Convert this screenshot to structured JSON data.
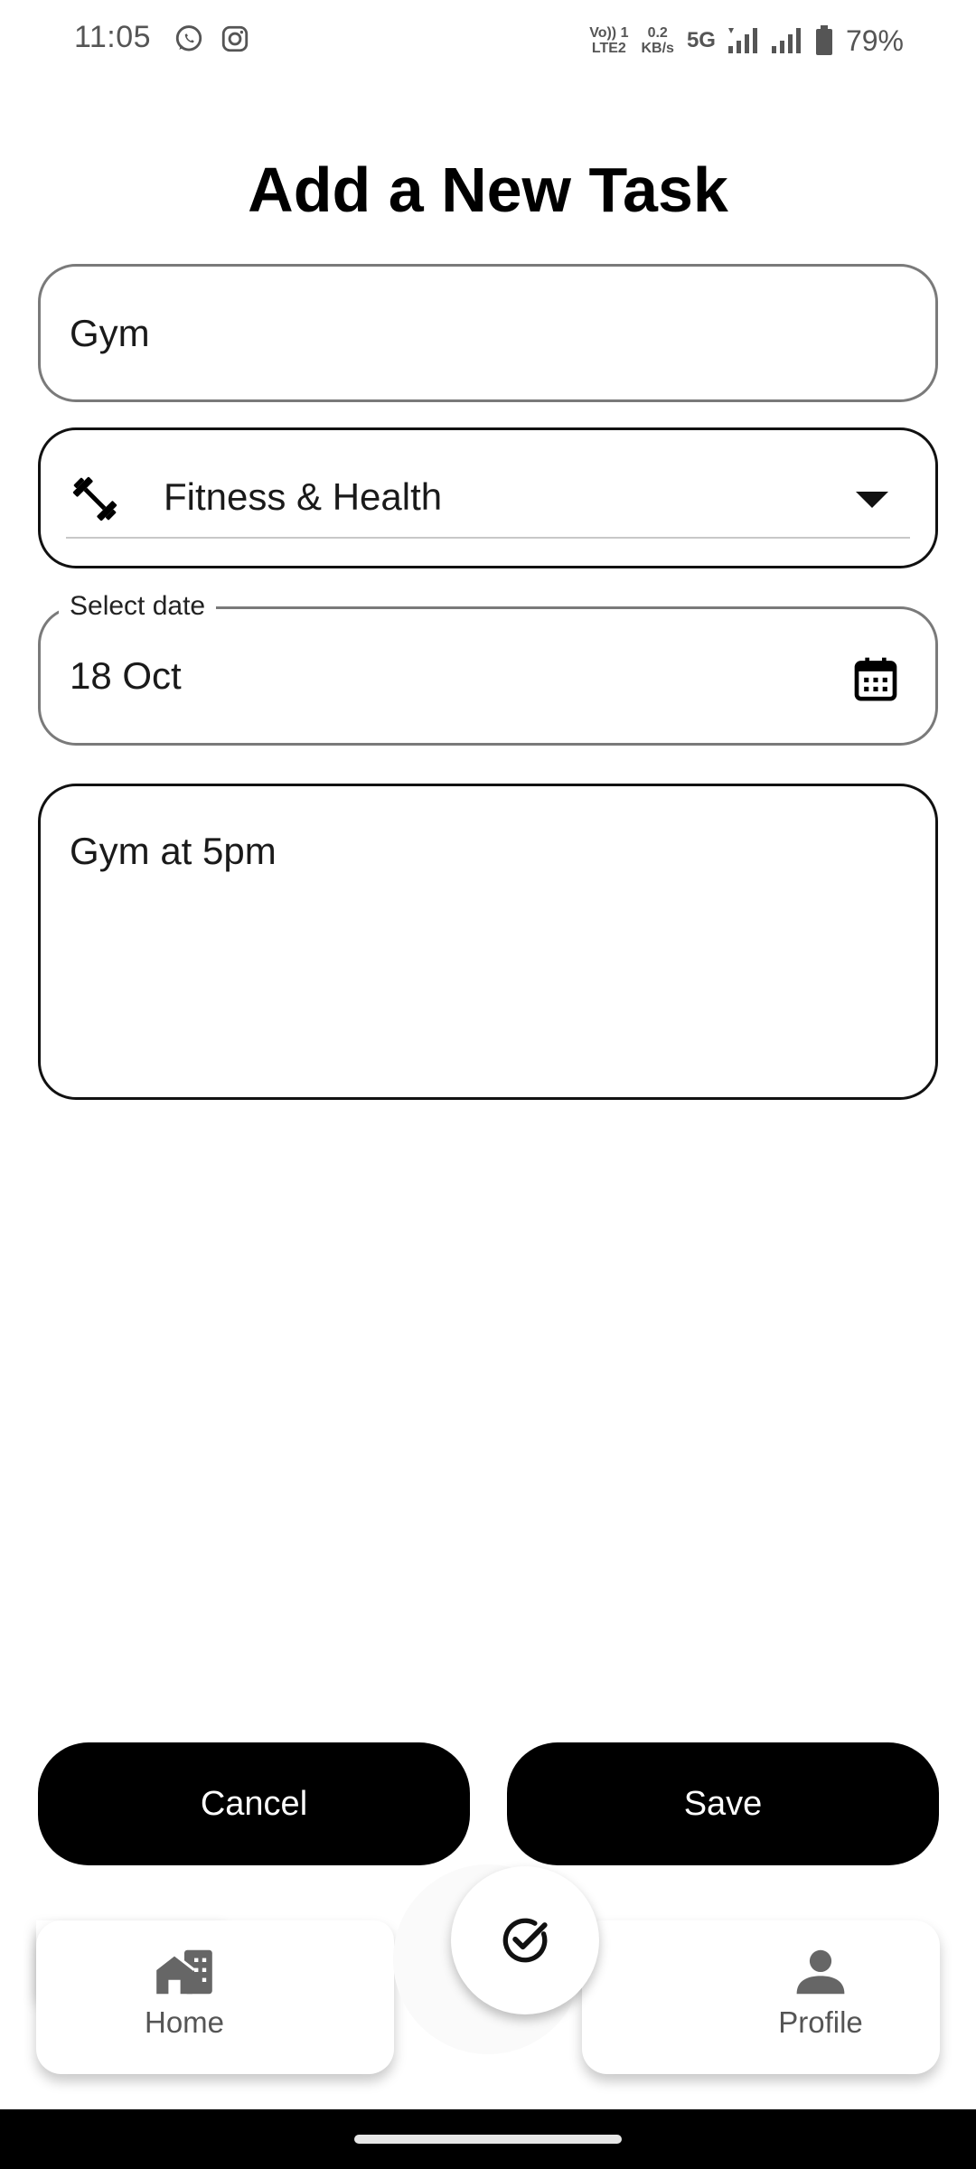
{
  "status_bar": {
    "time": "11:05",
    "app_icons": [
      "whatsapp-icon",
      "instagram-icon"
    ],
    "volte_line1": "Vo)) 1",
    "volte_line2": "LTE2",
    "speed_value": "0.2",
    "speed_unit": "KB/s",
    "network": "5G",
    "battery": "79%"
  },
  "page": {
    "title": "Add a New Task"
  },
  "form": {
    "task_name": "Gym",
    "category": {
      "selected": "Fitness & Health",
      "icon": "dumbbell-icon"
    },
    "date": {
      "label": "Select date",
      "value": "18 Oct",
      "icon": "calendar-icon"
    },
    "notes": "Gym at 5pm"
  },
  "actions": {
    "cancel_label": "Cancel",
    "save_label": "Save"
  },
  "bottom_nav": {
    "home_label": "Home",
    "home_icon": "home-icon",
    "center_icon": "check-circle-icon",
    "profile_label": "Profile",
    "profile_icon": "person-icon"
  },
  "colors": {
    "primary": "#000000",
    "background": "#ffffff",
    "muted_text": "#555555"
  }
}
